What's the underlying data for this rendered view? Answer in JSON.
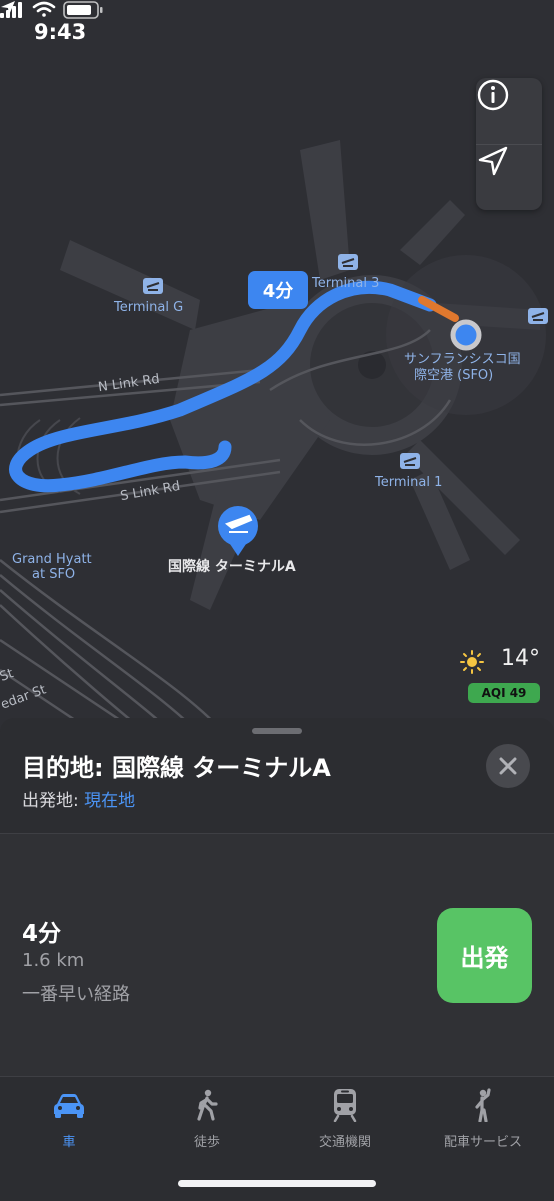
{
  "status_bar": {
    "time": "9:43"
  },
  "map": {
    "labels": {
      "terminal_3": "Terminal 3",
      "terminal_g": "Terminal G",
      "terminal_1": "Terminal 1",
      "sfo_line1": "サンフランシスコ国",
      "sfo_line2": "際空港 (SFO)",
      "n_link_rd": "N Link Rd",
      "s_link_rd": "S Link Rd",
      "grand_hyatt_line1": "Grand Hyatt",
      "grand_hyatt_line2": "at SFO",
      "destination": "国際線 ターミナルA",
      "st_fragment": "St",
      "cedar_fragment": "edar St"
    },
    "route_badge": "4分",
    "weather": {
      "temperature": "14°",
      "aqi": "AQI 49"
    },
    "colors": {
      "route": "#3d86f0",
      "traffic": "#e0782e",
      "current_location": "#3d86f0"
    }
  },
  "sheet": {
    "title": "目的地: 国際線 ターミナルA",
    "origin_label": "出発地:",
    "origin_value": "現在地",
    "route": {
      "duration": "4分",
      "distance": "1.6 km",
      "description": "一番早い経路",
      "go_label": "出発"
    }
  },
  "tabs": [
    {
      "label": "車",
      "icon": "car-icon",
      "active": true
    },
    {
      "label": "徒歩",
      "icon": "walking-icon",
      "active": false
    },
    {
      "label": "交通機関",
      "icon": "train-icon",
      "active": false
    },
    {
      "label": "配車サービス",
      "icon": "ride-share-icon",
      "active": false
    }
  ]
}
